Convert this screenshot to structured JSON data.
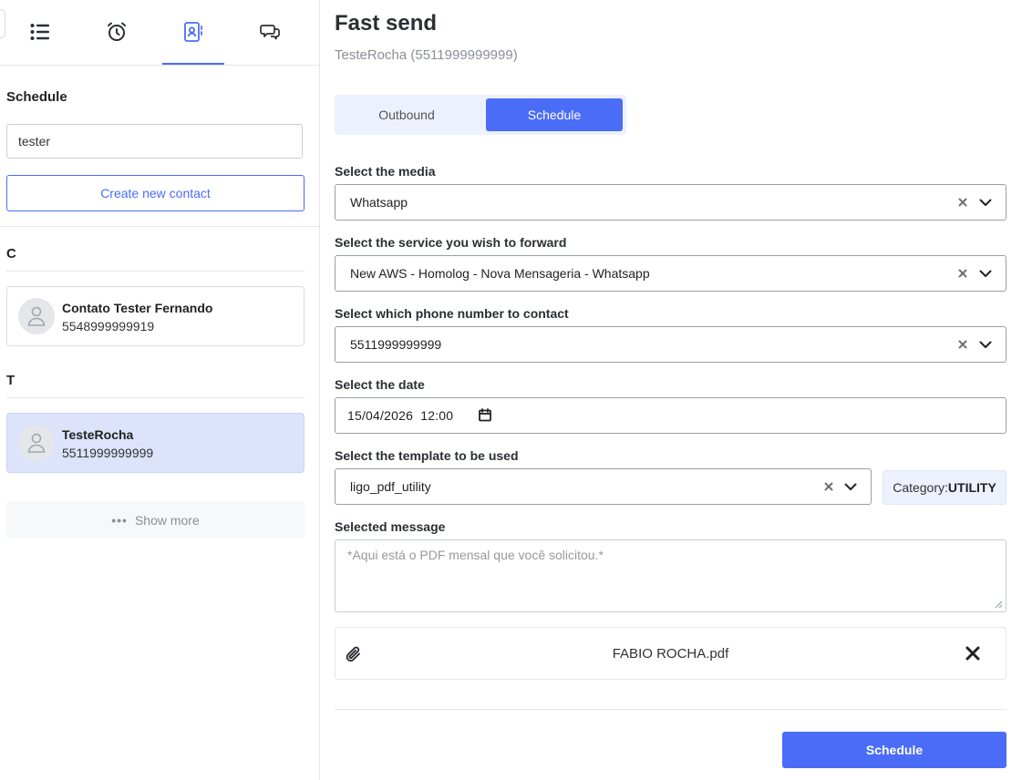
{
  "sidebar": {
    "tabs": [
      {
        "icon": "list-icon",
        "active": false
      },
      {
        "icon": "alarm-clock-icon",
        "active": false
      },
      {
        "icon": "contact-book-icon",
        "active": true
      },
      {
        "icon": "chat-bubbles-icon",
        "active": false
      }
    ],
    "section_title": "Schedule",
    "search_value": "tester",
    "create_label": "Create new contact",
    "groups": [
      {
        "letter": "C",
        "contacts": [
          {
            "name": "Contato Tester Fernando",
            "phone": "5548999999919",
            "selected": false
          }
        ]
      },
      {
        "letter": "T",
        "contacts": [
          {
            "name": "TesteRocha",
            "phone": "5511999999999",
            "selected": true
          }
        ]
      }
    ],
    "show_more": "Show more"
  },
  "main": {
    "title": "Fast send",
    "subtitle": "TesteRocha (5511999999999)",
    "segments": {
      "outbound": "Outbound",
      "schedule": "Schedule"
    },
    "media": {
      "label": "Select the media",
      "value": "Whatsapp"
    },
    "service": {
      "label": "Select the service you wish to forward",
      "value": "New AWS - Homolog - Nova Mensageria - Whatsapp"
    },
    "phone": {
      "label": "Select which phone number to contact",
      "value": "5511999999999"
    },
    "date": {
      "label": "Select the date",
      "value": "15/04/2026  12:00"
    },
    "template": {
      "label": "Select the template to be used",
      "value": "ligo_pdf_utility",
      "category_label": "Category:",
      "category_value": "UTILITY"
    },
    "message": {
      "label": "Selected message",
      "value": "*Aqui está o PDF mensal que você solicitou.*"
    },
    "attachment": {
      "filename": "FABIO ROCHA.pdf"
    },
    "submit_label": "Schedule"
  },
  "colors": {
    "accent": "#4a6cf7",
    "selected_card": "#dce3fb",
    "segment_bg": "#edf1fd"
  }
}
